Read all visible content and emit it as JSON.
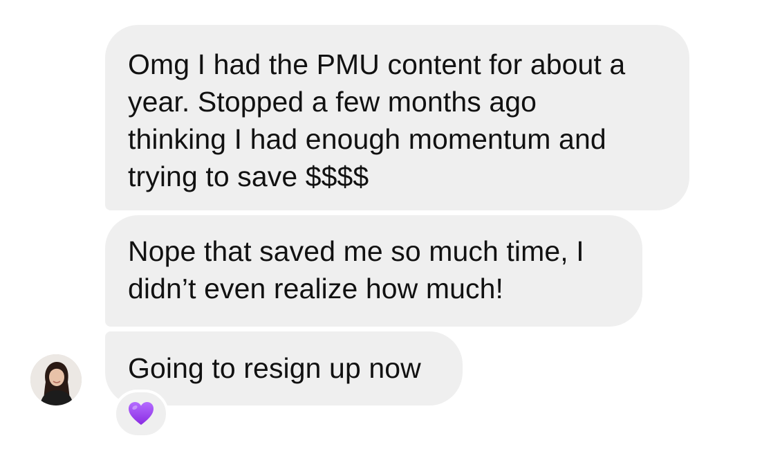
{
  "messages": [
    {
      "text": "Omg I had the PMU content for about a\nyear. Stopped a few months ago\nthinking I had enough momentum and\ntrying to save $$$$"
    },
    {
      "text": "Nope that saved me so much time, I\ndidn’t even realize how much!"
    },
    {
      "text": "Going to resign up now"
    }
  ],
  "reaction": {
    "icon": "purple-heart-icon",
    "color": "#9b3cf0"
  },
  "avatar": {
    "icon": "profile-photo"
  },
  "colors": {
    "bubble": "#efefef",
    "text": "#111111"
  }
}
